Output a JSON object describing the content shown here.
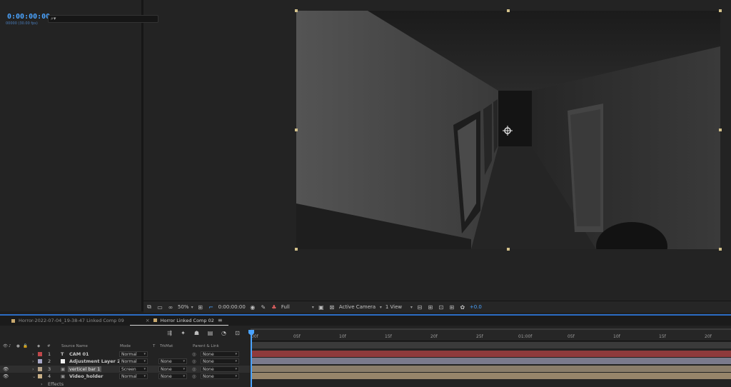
{
  "viewer": {
    "toolbar": {
      "zoom": "50%",
      "timecode": "0:00:00:00",
      "resolution": "Full",
      "camera": "Active Camera",
      "views": "1 View",
      "exposure": "+0.0"
    }
  },
  "timeline": {
    "tabs": [
      {
        "label": "Horror-2022-07-04_19-38-47 Linked Comp 09",
        "active": false
      },
      {
        "label": "Horror Linked Comp 02",
        "active": true
      }
    ],
    "timecode": "0:00:00:00",
    "fps": "00000 (30.00 fps)",
    "search_placeholder": "⌕▾",
    "columns": {
      "number": "#",
      "source_name": "Source Name",
      "mode": "Mode",
      "t": "T",
      "trkmat": "TrkMat",
      "parent": "Parent & Link"
    },
    "layers": [
      {
        "num": "1",
        "name": "CAM 01",
        "mode": "Normal",
        "trkmat": "",
        "parent": "None",
        "color": "#c0474a",
        "type": "T"
      },
      {
        "num": "2",
        "name": "Adjustment Layer 2",
        "mode": "Normal",
        "trkmat": "None",
        "parent": "None",
        "color": "#a8a8c8",
        "type": "□"
      },
      {
        "num": "3",
        "name": "verticel bar 1",
        "mode": "Screen",
        "trkmat": "None",
        "parent": "None",
        "color": "#b7a48a",
        "type": "▣"
      },
      {
        "num": "4",
        "name": "Video_holder",
        "mode": "Normal",
        "trkmat": "None",
        "parent": "None",
        "color": "#c9b087",
        "type": "▣"
      }
    ],
    "effects_label": "Effects",
    "ruler_labels": [
      "00f",
      "05f",
      "10f",
      "15f",
      "20f",
      "25f",
      "01:00f",
      "05f",
      "10f",
      "15f",
      "20f"
    ],
    "colors": {
      "accent": "#4aa3ff",
      "layer1_bar": "#8e3a3c",
      "layer2_bar": "#7a7a8c",
      "layer3_bar": "#8a7d6a",
      "layer4_bar": "#97856a"
    }
  }
}
